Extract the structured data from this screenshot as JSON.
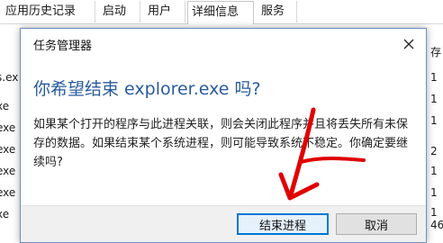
{
  "background": {
    "tabs": [
      {
        "label": "应用历史记录"
      },
      {
        "label": "启动"
      },
      {
        "label": "用户"
      },
      {
        "label": "详细信息"
      },
      {
        "label": "服务"
      }
    ],
    "left_rows": [
      "s.ex",
      "xe",
      "exe",
      "exe",
      "exe",
      "exe",
      "xe"
    ],
    "right_header": "存",
    "right_rows": [
      "1",
      "1",
      "1",
      "2",
      "1",
      "1",
      "1",
      "46"
    ]
  },
  "dialog": {
    "title": "任务管理器",
    "close_icon": "close-icon",
    "question": "你希望结束 explorer.exe 吗?",
    "message": "如果某个打开的程序与此进程关联，则会关闭此程序并且将丢失所有未保存的数据。如果结束某个系统进程，则可能导致系统不稳定。你确定要继续吗?",
    "primary_button": "结束进程",
    "cancel_button": "取消"
  },
  "annotation": {
    "arrow_color": "#e00000"
  }
}
